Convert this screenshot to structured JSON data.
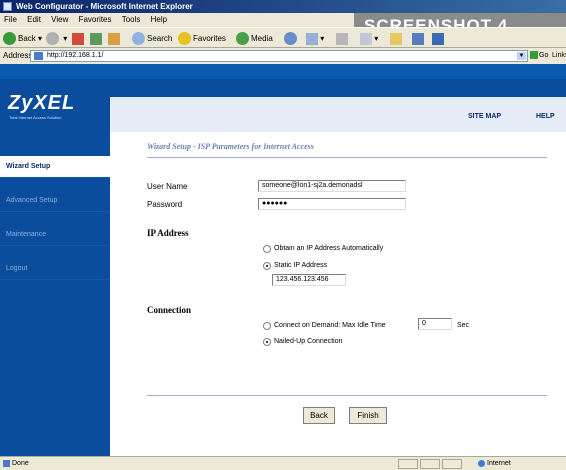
{
  "window": {
    "title": "Web Configurator - Microsoft Internet Explorer"
  },
  "badge": "SCREENSHOT 4",
  "menu": [
    "File",
    "Edit",
    "View",
    "Favorites",
    "Tools",
    "Help"
  ],
  "toolbar": {
    "back": "Back",
    "search": "Search",
    "favorites": "Favorites",
    "media": "Media"
  },
  "address": {
    "label": "Address",
    "url": "http://192.168.1.1/",
    "go": "Go",
    "links": "Links"
  },
  "brand": {
    "logo": "ZyXEL",
    "tagline": "Total Internet Access Solution"
  },
  "header_links": {
    "sitemap": "SITE MAP",
    "help": "HELP"
  },
  "sidebar": {
    "items": [
      {
        "label": "Wizard Setup",
        "active": true
      },
      {
        "label": "Advanced Setup",
        "active": false
      },
      {
        "label": "Maintenance",
        "active": false
      },
      {
        "label": "Logout",
        "active": false
      }
    ]
  },
  "wizard": {
    "title": "Wizard Setup - ISP Parameters for Internet Access",
    "username_label": "User Name",
    "username_value": "someone@lon1-sj2a.demonadsl",
    "password_label": "Password",
    "password_value": "●●●●●●",
    "ip_section": "IP Address",
    "ip_auto": "Obtain an IP Address Automatically",
    "ip_static": "Static IP Address",
    "ip_value": "123.456.123.456",
    "connection_section": "Connection",
    "conn_demand": "Connect on Demand: Max Idle Time",
    "idle_value": "0",
    "idle_unit": "Sec",
    "conn_nailed": "Nailed-Up Connection",
    "back": "Back",
    "finish": "Finish"
  },
  "status": {
    "text": "Done",
    "zone": "Internet"
  }
}
